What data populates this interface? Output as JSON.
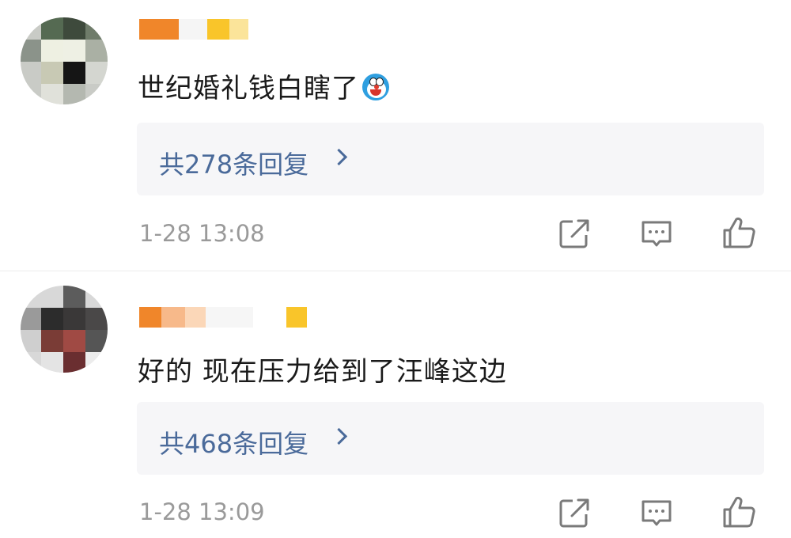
{
  "comments": [
    {
      "text": "世纪婚礼钱白瞎了",
      "emoji": "doraemon-emoji",
      "replies_label": "共278条回复",
      "time": "1-28 13:08",
      "icons": {
        "share": "share-icon",
        "reply": "comment-icon",
        "like": "thumbs-up-icon"
      }
    },
    {
      "text": "好的 现在压力给到了汪峰这边",
      "replies_label": "共468条回复",
      "time": "1-28 13:09",
      "icons": {
        "share": "share-icon",
        "reply": "comment-icon",
        "like": "thumbs-up-icon"
      }
    }
  ],
  "colors": {
    "reply_link": "#4a6a9a",
    "timestamp": "#9a9a9a",
    "reply_box_bg": "#f6f6f8",
    "username_orange": "#f08a24",
    "username_yellow": "#f9c52a"
  }
}
